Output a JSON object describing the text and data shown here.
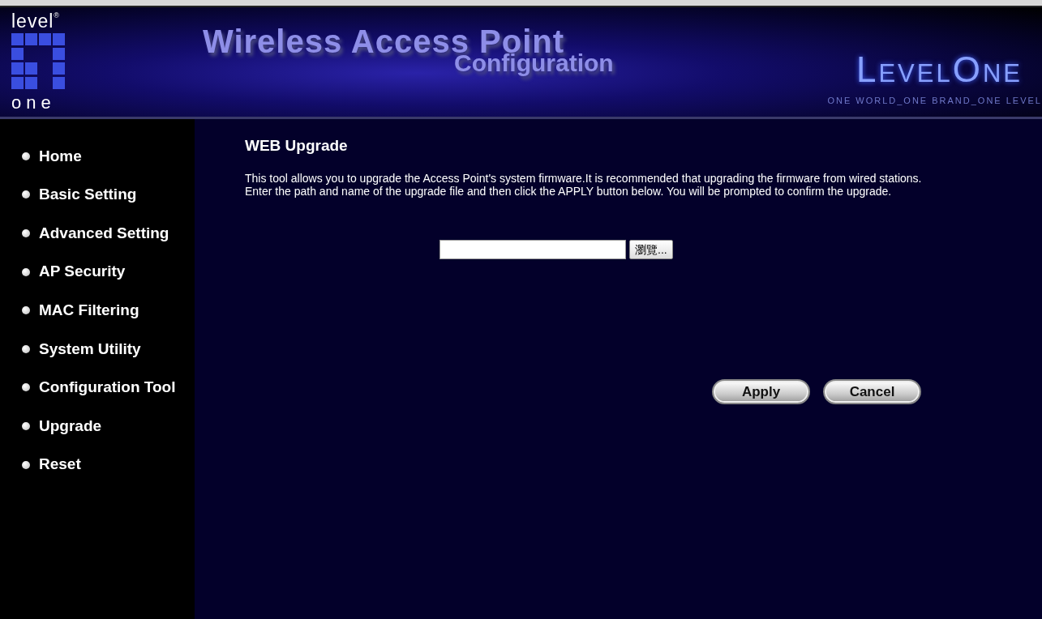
{
  "header": {
    "logo_top": "level",
    "logo_mark": "®",
    "logo_bottom": "one",
    "title": "Wireless Access Point",
    "subtitle": "Configuration",
    "brand": "LevelOne",
    "slogan": "ONE WORLD_ONE BRAND_ONE LEVEL"
  },
  "sidebar": {
    "items": [
      {
        "label": "Home"
      },
      {
        "label": "Basic Setting"
      },
      {
        "label": "Advanced Setting"
      },
      {
        "label": "AP Security"
      },
      {
        "label": "MAC Filtering"
      },
      {
        "label": "System Utility"
      },
      {
        "label": "Configuration Tool"
      },
      {
        "label": "Upgrade"
      },
      {
        "label": "Reset"
      }
    ]
  },
  "content": {
    "heading": "WEB Upgrade",
    "paragraphs": [
      "This tool allows you to upgrade the Access Point's system firmware.It is recommended that upgrading the firmware from wired stations.",
      "Enter the path and name of the upgrade file and then click the APPLY button below. You will be prompted to confirm the upgrade."
    ],
    "browse_button": "瀏覽...",
    "buttons": [
      "Apply",
      "Cancel"
    ]
  }
}
